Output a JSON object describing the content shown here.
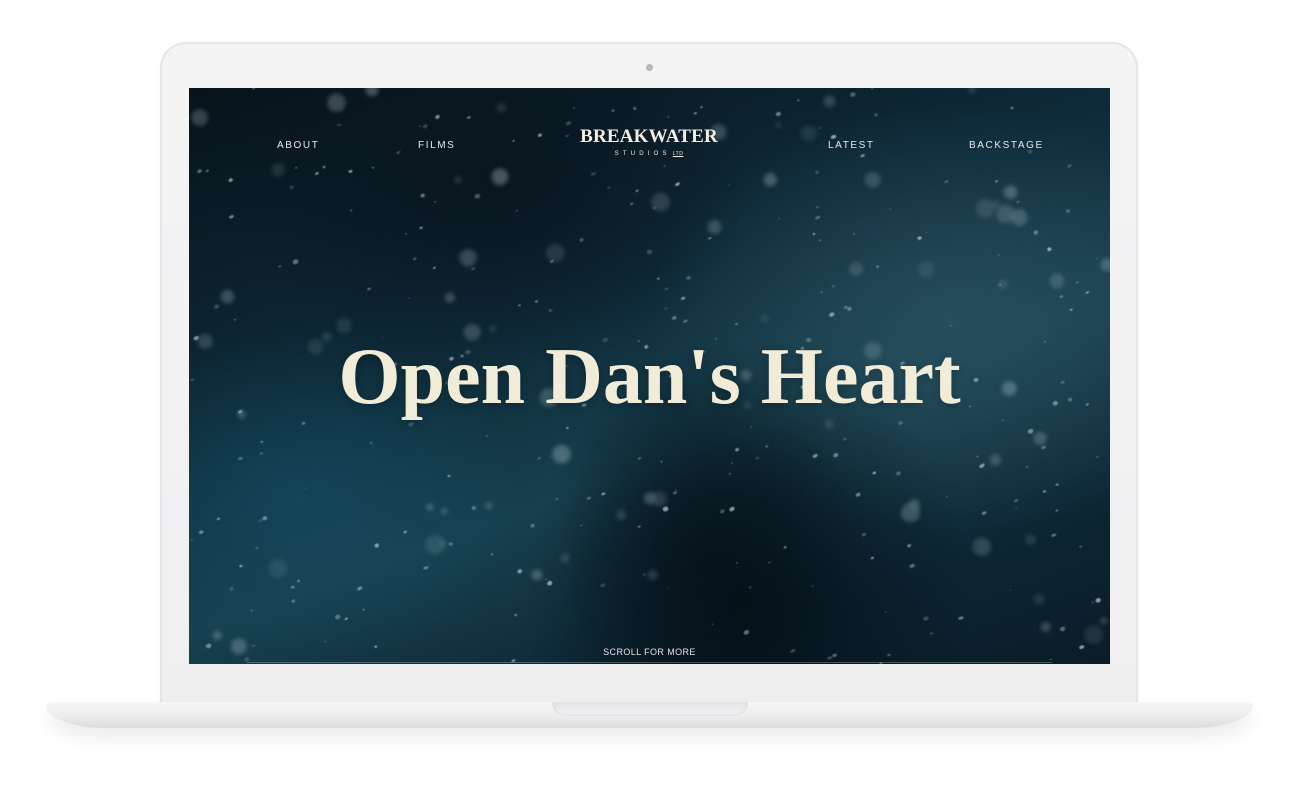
{
  "nav": {
    "left_items": [
      "ABOUT",
      "FILMS"
    ],
    "right_items": [
      "LATEST",
      "BACKSTAGE"
    ]
  },
  "logo": {
    "main": "BREAKWATER",
    "sub": "STUDIOS",
    "suffix": "LTD"
  },
  "hero": {
    "title": "Open Dan's Heart"
  },
  "footer": {
    "scroll_label": "SCROLL FOR MORE"
  },
  "colors": {
    "hero_text": "#f1ecd8",
    "nav_text": "#e6e9ea",
    "background_dark": "#0e2a38",
    "laptop_shell": "#f4f4f5"
  }
}
